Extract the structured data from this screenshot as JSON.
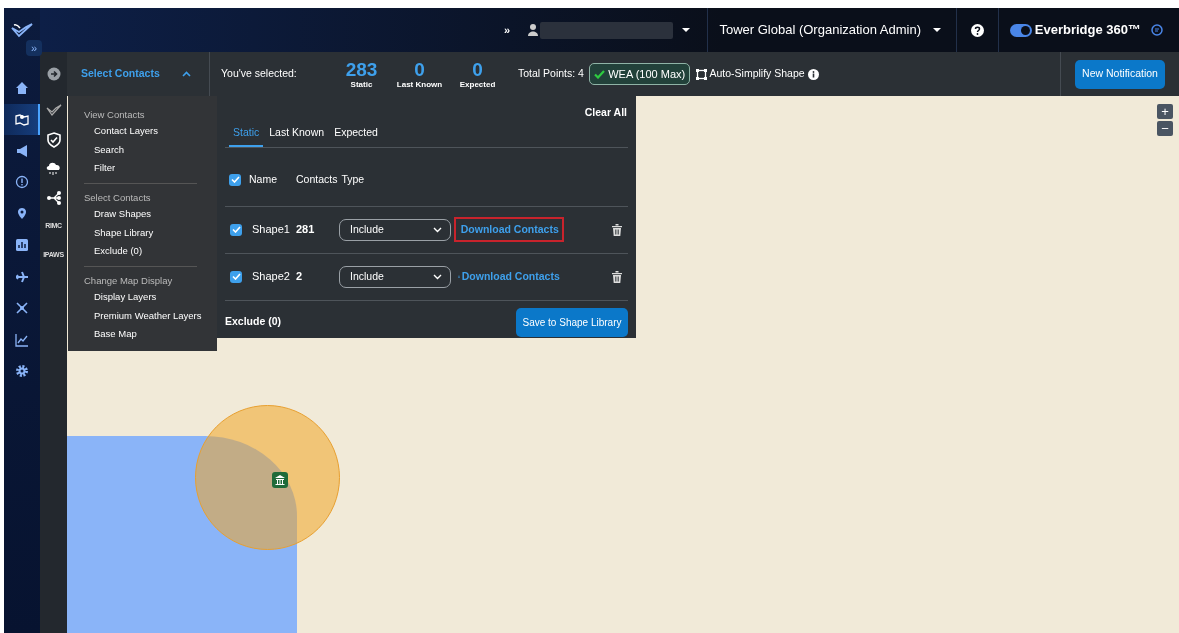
{
  "top_bar": {
    "expand": "»",
    "forward": "»",
    "org": "Tower Global (Organization Admin)",
    "brand": "Everbridge 360™",
    "toggle_on": true
  },
  "left_nav": [
    {
      "kind": "home",
      "selected": false
    },
    {
      "kind": "map",
      "selected": true
    },
    {
      "kind": "megaphone",
      "selected": false
    },
    {
      "kind": "alert",
      "selected": false
    },
    {
      "kind": "pin",
      "selected": false
    },
    {
      "kind": "bars",
      "selected": false
    },
    {
      "kind": "plane",
      "selected": false
    },
    {
      "kind": "drone",
      "selected": false
    },
    {
      "kind": "trend",
      "selected": false
    },
    {
      "kind": "gear",
      "selected": false
    }
  ],
  "tool_rail": [
    {
      "kind": "bird"
    },
    {
      "kind": "shield"
    },
    {
      "kind": "cloud"
    },
    {
      "kind": "share"
    },
    {
      "kind": "label",
      "text": "RIMC"
    },
    {
      "kind": "label",
      "text": "IPAWS"
    }
  ],
  "toolbar": {
    "menu_label": "Select Contacts",
    "menu_open": true,
    "selected_label": "You've selected:",
    "counts": [
      {
        "value": "283",
        "label": "Static"
      },
      {
        "value": "0",
        "label": "Last Known"
      },
      {
        "value": "0",
        "label": "Expected"
      }
    ],
    "total_points": "Total Points: 4",
    "wea": {
      "label": "WEA (100 Max)",
      "checked": true
    },
    "auto_simplify": "Auto-Simplify Shape",
    "new_notification": "New Notification"
  },
  "menu": [
    {
      "heading": "View Contacts",
      "items": [
        "Contact Layers",
        "Search",
        "Filter"
      ]
    },
    {
      "heading": "Select Contacts",
      "items": [
        "Draw Shapes",
        "Shape Library",
        "Exclude (0)"
      ]
    },
    {
      "heading": "Change Map Display",
      "items": [
        "Display Layers",
        "Premium Weather Layers",
        "Base Map"
      ]
    }
  ],
  "shapes_panel": {
    "clear_all": "Clear All",
    "tabs": [
      {
        "label": "Static",
        "selected": true
      },
      {
        "label": "Last Known",
        "selected": false
      },
      {
        "label": "Expected",
        "selected": false
      }
    ],
    "all_checked": true,
    "columns": [
      "Name",
      "Contacts",
      "Type"
    ],
    "rows": [
      {
        "name": "Shape1",
        "contacts": "281",
        "type": "Include",
        "checked": true,
        "download": "Download Contacts",
        "highlighted": true
      },
      {
        "name": "Shape2",
        "contacts": "2",
        "type": "Include",
        "checked": true,
        "download": "Download Contacts",
        "highlighted": false
      }
    ],
    "exclude": "Exclude (0)",
    "save": "Save to Shape Library"
  },
  "map": {
    "zoom_in": "+",
    "zoom_out": "−"
  }
}
